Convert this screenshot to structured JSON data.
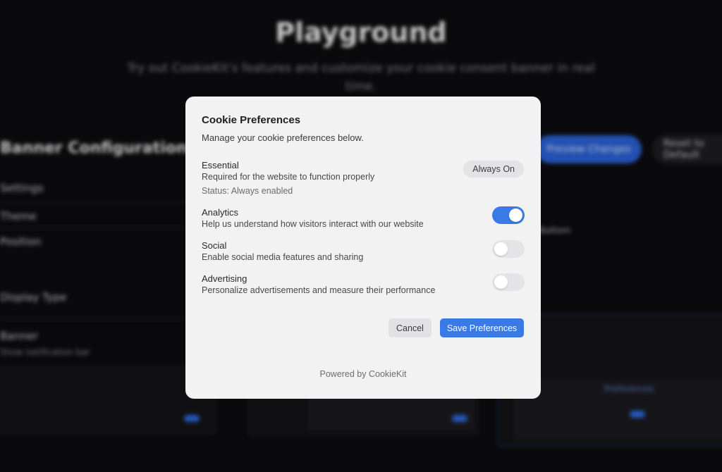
{
  "background": {
    "title": "Playground",
    "subtitle": "Try out CookieKit's features and customize your cookie consent banner in real time.",
    "section_title": "Banner Configuration",
    "rows": [
      "Settings",
      "Theme",
      "Position",
      "Display Type",
      "Banner"
    ],
    "row_hint": "Show notification bar",
    "primary_button": "Preview Changes",
    "secondary_button": "Reset to Default",
    "right_label": "Bottom",
    "card_label": "Preferences"
  },
  "modal": {
    "title": "Cookie Preferences",
    "description": "Manage your cookie preferences below.",
    "categories": [
      {
        "name": "Essential",
        "description": "Required for the website to function properly",
        "status": "Status: Always enabled",
        "badge": "Always On"
      },
      {
        "name": "Analytics",
        "description": "Help us understand how visitors interact with our website",
        "enabled": true
      },
      {
        "name": "Social",
        "description": "Enable social media features and sharing",
        "enabled": false
      },
      {
        "name": "Advertising",
        "description": "Personalize advertisements and measure their performance",
        "enabled": false
      }
    ],
    "cancel_label": "Cancel",
    "save_label": "Save Preferences",
    "footer": "Powered by CookieKit"
  },
  "colors": {
    "accent": "#3a7ae6",
    "modal_bg": "#f2f2f3",
    "page_bg": "#0d0d0f"
  }
}
